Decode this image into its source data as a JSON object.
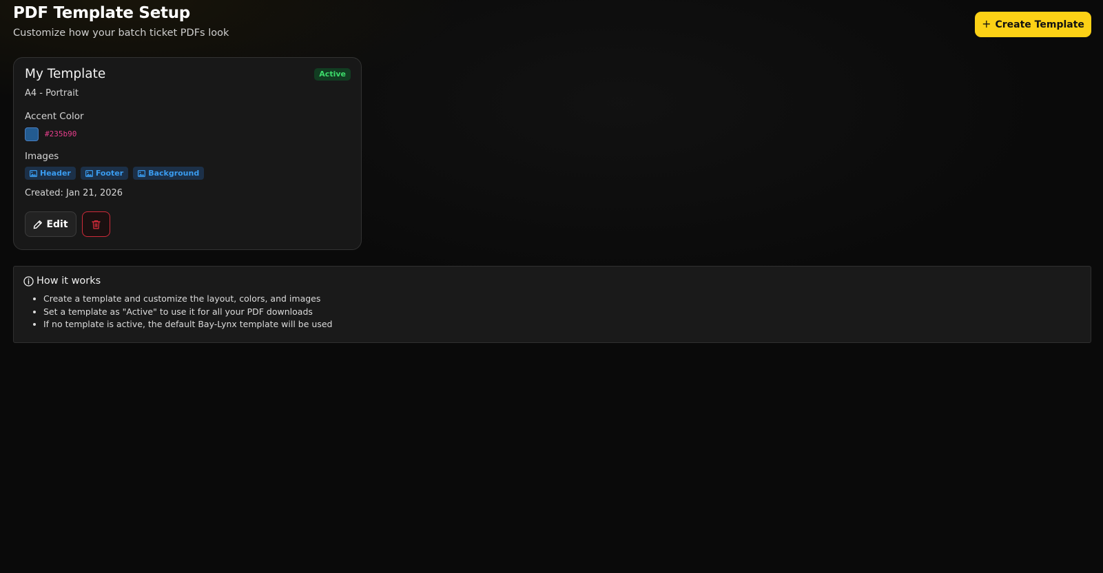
{
  "header": {
    "title": "PDF Template Setup",
    "subtitle": "Customize how your batch ticket PDFs look",
    "create_button_label": "Create Template",
    "create_button_icon": "plus-icon"
  },
  "template_card": {
    "name": "My Template",
    "status": "Active",
    "format": "A4 - Portrait",
    "accent_color_label": "Accent Color",
    "accent_color": "#235b90",
    "accent_color_display": "#235b90",
    "images_label": "Images",
    "images": [
      {
        "label": "Header",
        "icon": "image-icon"
      },
      {
        "label": "Footer",
        "icon": "image-icon"
      },
      {
        "label": "Background",
        "icon": "image-icon"
      }
    ],
    "created": "Created: Jan 21, 2026",
    "edit_label": "Edit",
    "edit_icon": "pencil-icon",
    "delete_icon": "trash-icon"
  },
  "info": {
    "title": "How it works",
    "icon": "info-icon",
    "items": [
      "Create a template and customize the layout, colors, and images",
      "Set a template as \"Active\" to use it for all your PDF downloads",
      "If no template is active, the default Bay-Lynx template will be used"
    ]
  },
  "colors": {
    "primary_button": "#fcd116",
    "active_badge_text": "#3ddc6b",
    "chip_text": "#3a9cf0",
    "hex_text": "#e83e8c",
    "delete_border": "#d12b3a"
  }
}
